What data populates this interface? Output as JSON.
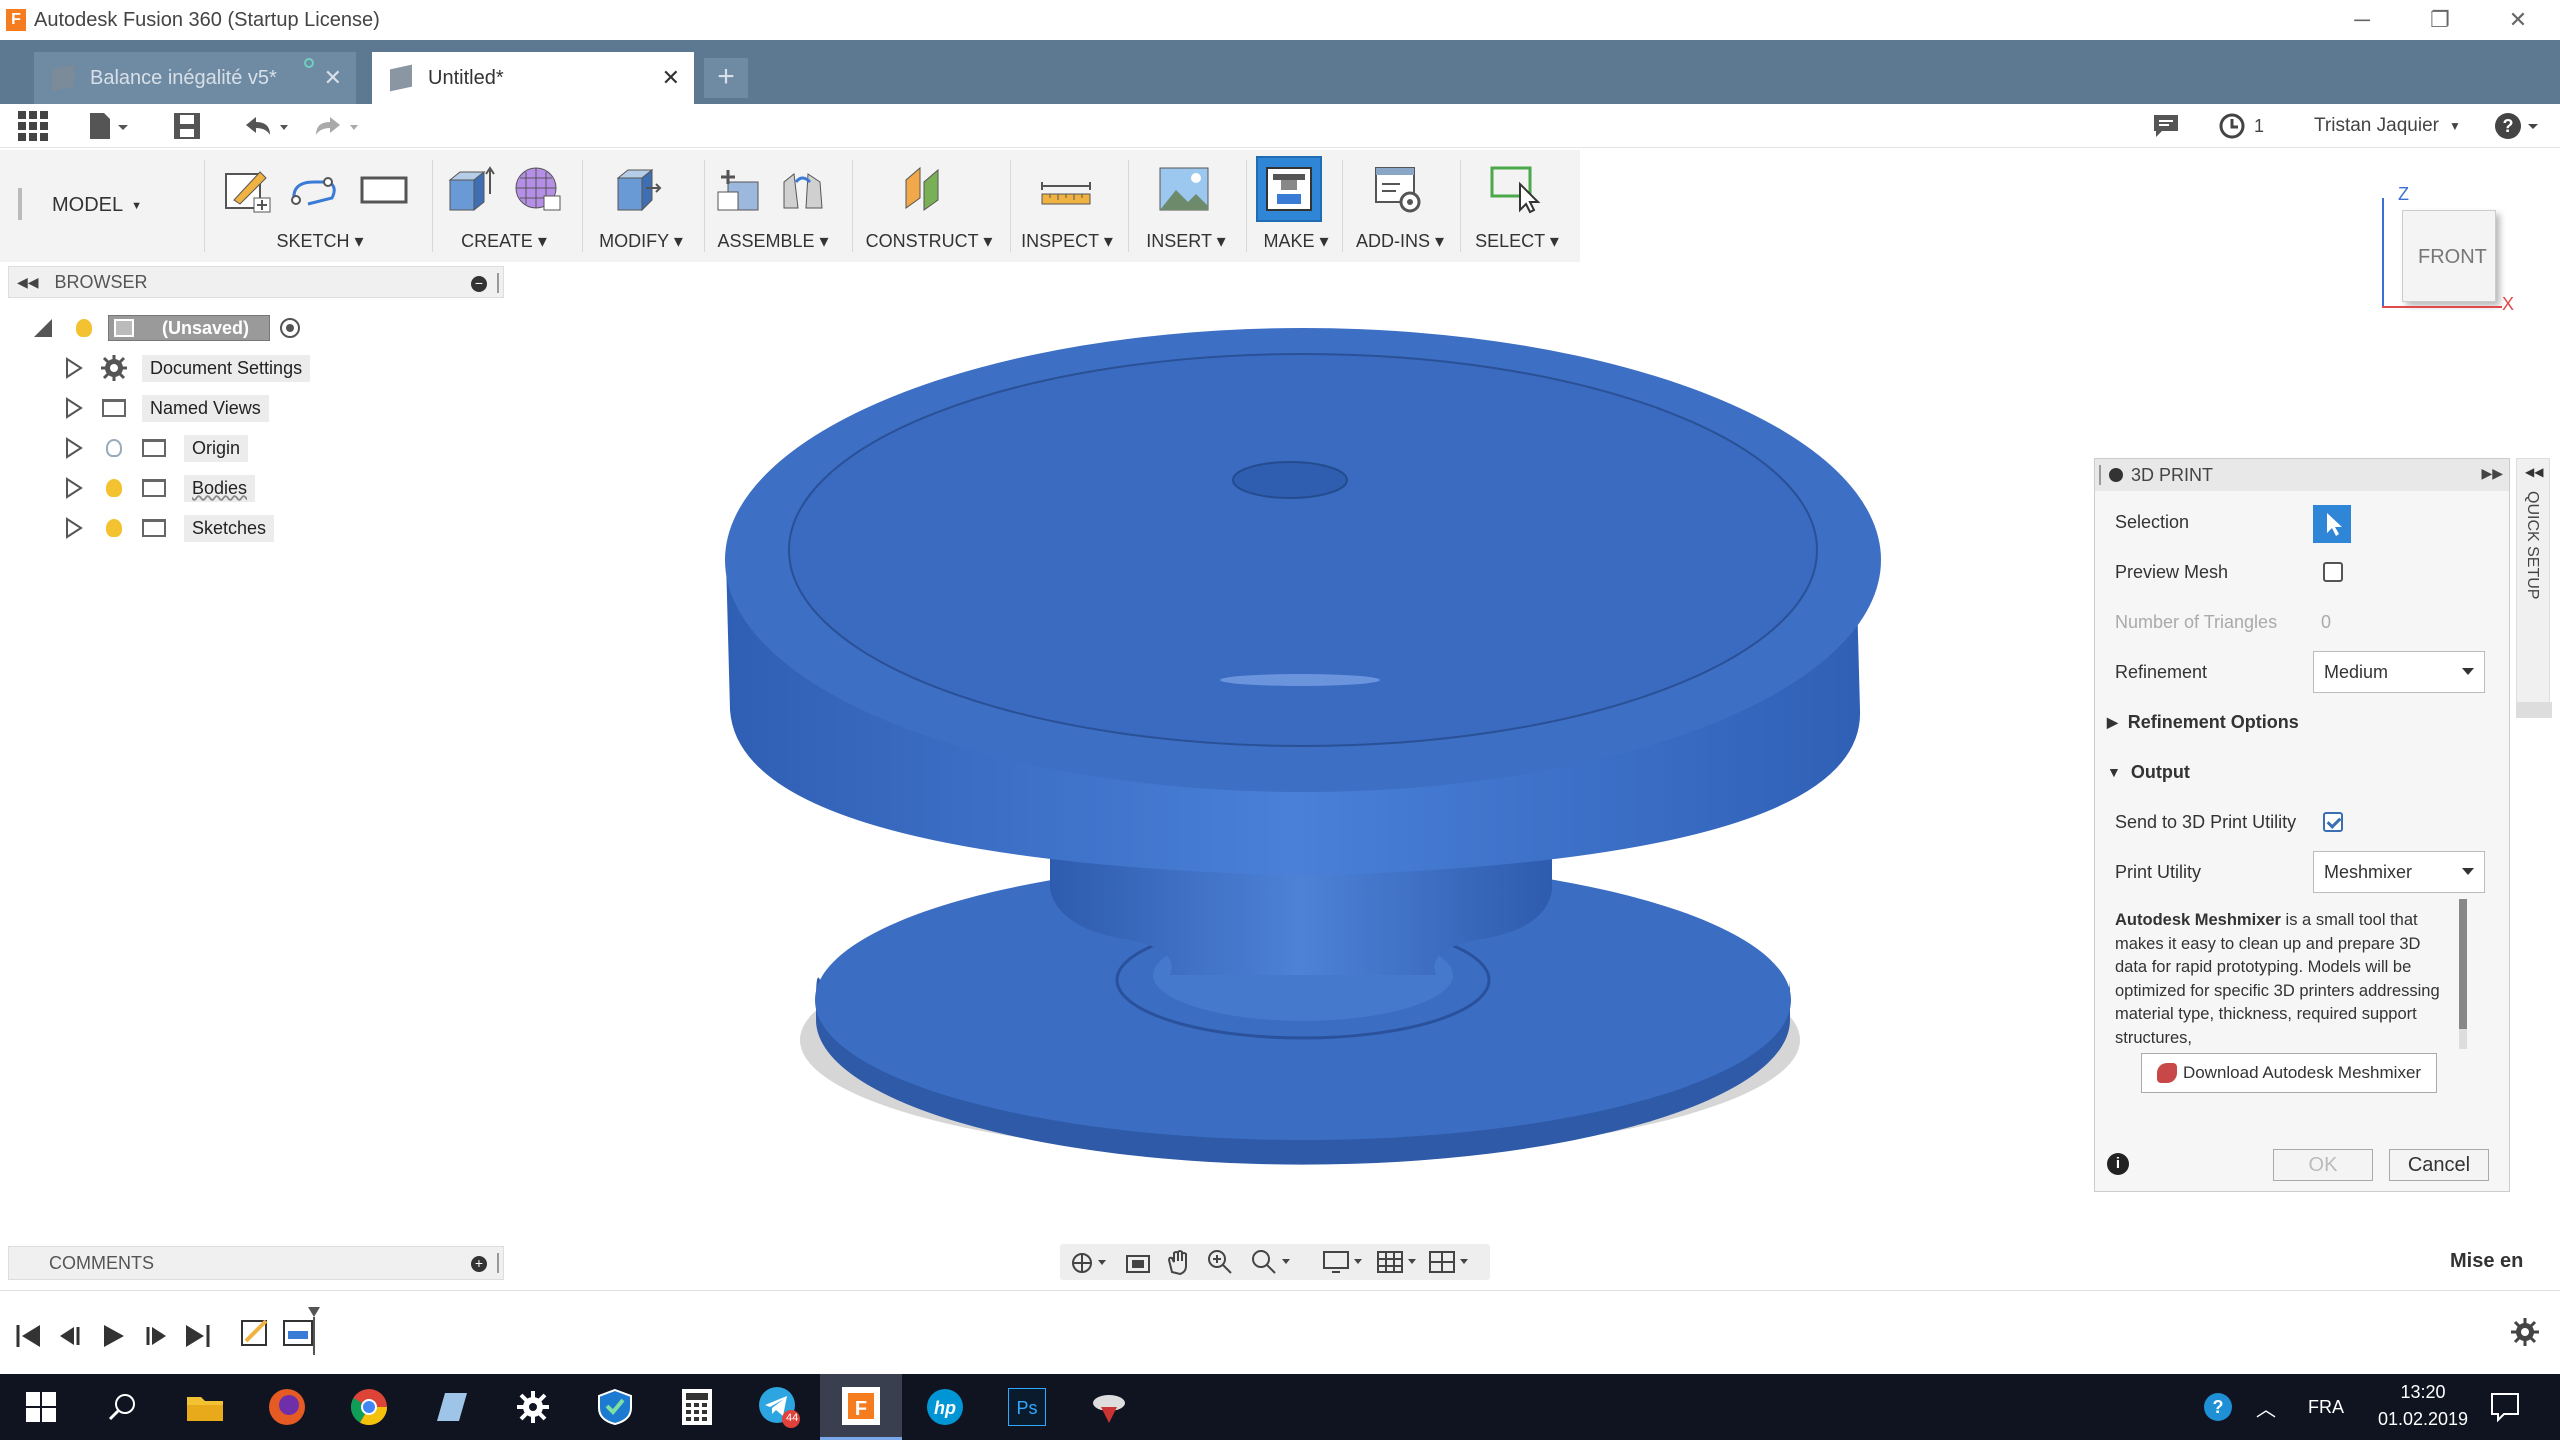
{
  "window": {
    "title": "Autodesk Fusion 360 (Startup License)",
    "app_letter": "F"
  },
  "tabs": [
    {
      "label": "Balance inégalité v5*"
    },
    {
      "label": "Untitled*"
    }
  ],
  "quickbar": {
    "user": "Tristan Jaquier",
    "jobs": "1"
  },
  "ribbon": {
    "workspace": "MODEL",
    "groups": [
      "SKETCH",
      "CREATE",
      "MODIFY",
      "ASSEMBLE",
      "CONSTRUCT",
      "INSPECT",
      "INSERT",
      "MAKE",
      "ADD-INS",
      "SELECT"
    ]
  },
  "browser": {
    "title": "BROWSER",
    "root": "(Unsaved)",
    "items": [
      "Document Settings",
      "Named Views",
      "Origin",
      "Bodies",
      "Sketches"
    ]
  },
  "viewcube": {
    "face": "FRONT",
    "z": "Z",
    "x": "X"
  },
  "print_panel": {
    "title": "3D PRINT",
    "selection_label": "Selection",
    "preview_label": "Preview Mesh",
    "triangles_label": "Number of Triangles",
    "triangles_value": "0",
    "refinement_label": "Refinement",
    "refinement_value": "Medium",
    "refinement_options": "Refinement Options",
    "output": "Output",
    "send_label": "Send to 3D Print Utility",
    "utility_label": "Print Utility",
    "utility_value": "Meshmixer",
    "desc_bold": "Autodesk Meshmixer",
    "desc_rest": " is a small tool that makes it easy to clean up and prepare 3D data for rapid prototyping. Models will be optimized for specific 3D printers addressing material type, thickness, required support structures,",
    "download": "Download Autodesk Meshmixer",
    "ok": "OK",
    "cancel": "Cancel"
  },
  "quick_setup": "QUICK SETUP",
  "comments": "COMMENTS",
  "status_right": "Mise en",
  "colors": {
    "model": "#3d6fc4",
    "tabbar": "#5d7891",
    "accent": "#1f8fd6"
  },
  "taskbar": {
    "lang": "FRA",
    "time": "13:20",
    "date": "01.02.2019",
    "badge": "44"
  }
}
